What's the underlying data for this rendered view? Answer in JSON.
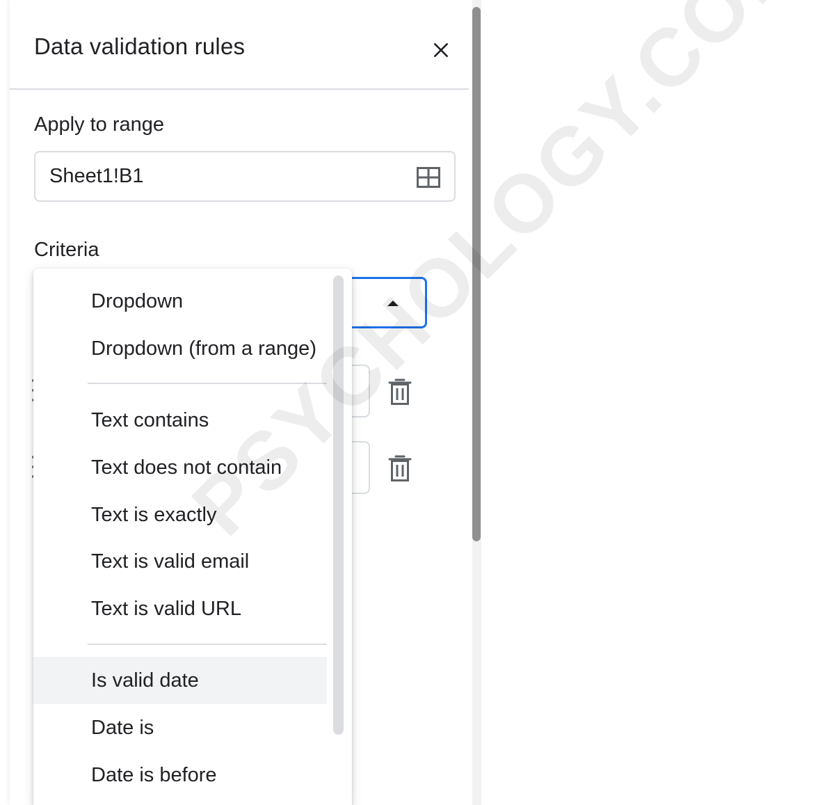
{
  "panel": {
    "title": "Data validation rules",
    "close_icon": "close-icon",
    "apply_to_range": {
      "label": "Apply to range",
      "value": "Sheet1!B1",
      "icon": "select-range-grid-icon"
    },
    "criteria": {
      "label": "Criteria",
      "expanded": true,
      "icon": "caret-up-icon"
    },
    "value_rows_icon": "trash-icon"
  },
  "criteria_menu": {
    "groups": [
      {
        "items": [
          "Dropdown",
          "Dropdown (from a range)"
        ]
      },
      {
        "items": [
          "Text contains",
          "Text does not contain",
          "Text is exactly",
          "Text is valid email",
          "Text is valid URL"
        ]
      },
      {
        "items": [
          "Is valid date",
          "Date is",
          "Date is before"
        ]
      }
    ],
    "hovered_item": "Is valid date"
  },
  "watermark": "PSYCHOLOGY.COM",
  "colors": {
    "accent": "#1a73e8",
    "border": "#dadce0",
    "text": "#202124",
    "hover": "#f1f3f4"
  }
}
